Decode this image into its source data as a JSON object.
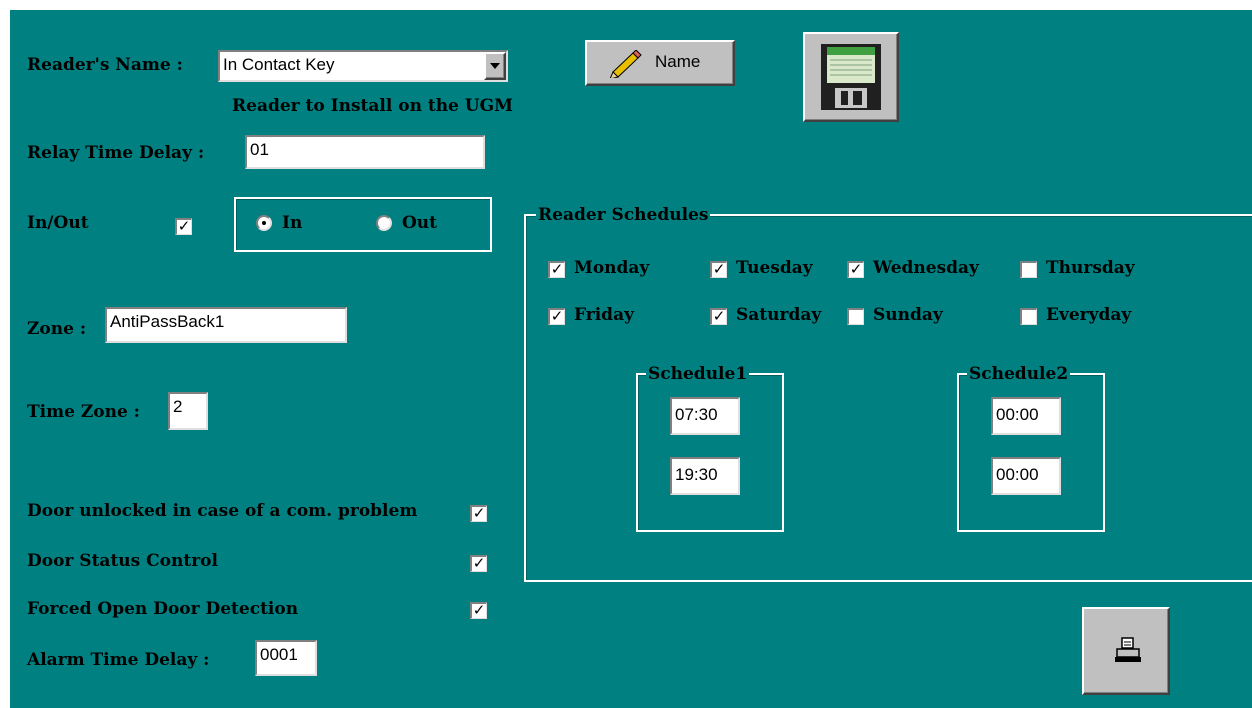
{
  "reader": {
    "name_label": "Reader's Name :",
    "name_value": "In Contact Key",
    "install_note": "Reader to Install on the UGM",
    "name_button_label": "Name"
  },
  "relay": {
    "label": "Relay Time Delay :",
    "value": "01"
  },
  "inout": {
    "label": "In/Out",
    "enabled": true,
    "options": [
      {
        "label": "In",
        "selected": true
      },
      {
        "label": "Out",
        "selected": false
      }
    ]
  },
  "zone": {
    "label": "Zone :",
    "value": "AntiPassBack1"
  },
  "timezone": {
    "label": "Time Zone :",
    "value": "2"
  },
  "options": [
    {
      "label": "Door unlocked in case of a com. problem",
      "checked": true
    },
    {
      "label": "Door Status Control",
      "checked": true
    },
    {
      "label": "Forced Open Door Detection",
      "checked": true
    }
  ],
  "alarm": {
    "label": "Alarm Time Delay :",
    "value": "0001"
  },
  "schedules": {
    "title": "Reader Schedules",
    "days": [
      {
        "label": "Monday",
        "checked": true
      },
      {
        "label": "Tuesday",
        "checked": true
      },
      {
        "label": "Wednesday",
        "checked": true
      },
      {
        "label": "Thursday",
        "checked": false
      },
      {
        "label": "Friday",
        "checked": true
      },
      {
        "label": "Saturday",
        "checked": true
      },
      {
        "label": "Sunday",
        "checked": false
      },
      {
        "label": "Everyday",
        "checked": false
      }
    ],
    "schedule1": {
      "title": "Schedule1",
      "start": "07:30",
      "end": "19:30"
    },
    "schedule2": {
      "title": "Schedule2",
      "start": "00:00",
      "end": "00:00"
    }
  },
  "icons": {
    "save": "floppy-disk-icon",
    "print": "printer-icon",
    "edit": "pencil-icon",
    "dropdown": "dropdown-arrow-icon"
  },
  "colors": {
    "background": "#008080",
    "control_face": "#c0c0c0",
    "field": "#ffffff"
  }
}
